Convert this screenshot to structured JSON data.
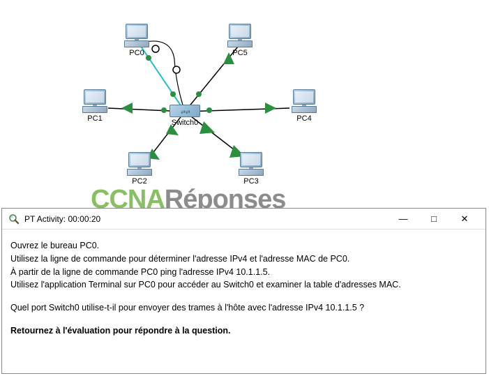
{
  "topology": {
    "devices": {
      "pc0": {
        "label": "PC0"
      },
      "pc1": {
        "label": "PC1"
      },
      "pc2": {
        "label": "PC2"
      },
      "pc3": {
        "label": "PC3"
      },
      "pc4": {
        "label": "PC4"
      },
      "pc5": {
        "label": "PC5"
      },
      "switch0": {
        "label": "Switch0"
      }
    }
  },
  "watermark": {
    "part1": "CCNA",
    "part2": "Réponses"
  },
  "window": {
    "title": "PT Activity: 00:00:20",
    "controls": {
      "minimize": "—",
      "maximize": "□",
      "close": "✕"
    },
    "content": {
      "line1": "Ouvrez le bureau PC0.",
      "line2": "Utilisez la ligne de commande pour déterminer l'adresse IPv4 et l'adresse MAC de PC0.",
      "line3": "À partir de la ligne de commande PC0 ping l'adresse IPv4 10.1.1.5.",
      "line4": "Utilisez l'application Terminal sur PC0 pour accéder au Switch0 et examiner la table d'adresses MAC.",
      "line5": "Quel port Switch0 utilise-t-il pour envoyer des trames à l'hôte avec l'adresse IPv4 10.1.1.5 ?",
      "line6": "Retournez à l'évaluation pour répondre à la question."
    }
  }
}
